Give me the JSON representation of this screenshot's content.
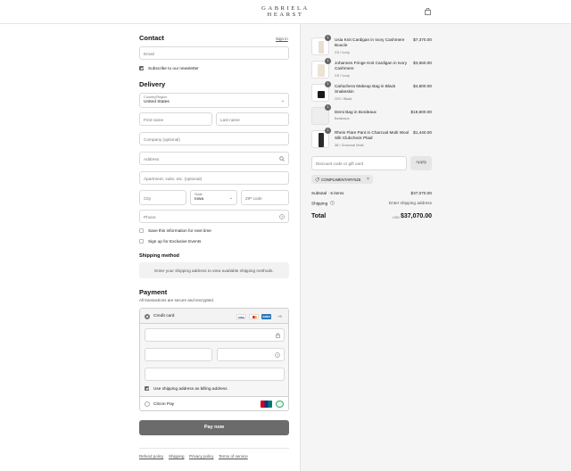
{
  "brand": {
    "logo_line1": "GABRIELA",
    "logo_line2": "HEARST",
    "bag_icon": "shopping-bag-icon"
  },
  "contact": {
    "title": "Contact",
    "sign_in": "Sign in",
    "email_placeholder": "Email",
    "newsletter_label": "Subscribe to our newsletter",
    "newsletter_checked": true
  },
  "delivery": {
    "title": "Delivery",
    "country_label": "Country/Region",
    "country_value": "United States",
    "first_name_placeholder": "First name",
    "last_name_placeholder": "Last name",
    "company_placeholder": "Company (optional)",
    "address_placeholder": "Address",
    "apartment_placeholder": "Apartment, suite, etc. (optional)",
    "city_placeholder": "City",
    "state_label": "State",
    "state_value": "Iowa",
    "zip_placeholder": "ZIP code",
    "phone_placeholder": "Phone",
    "save_info_label": "Save this information for next time",
    "exclusive_events_label": "Sign up for Exclusive Events"
  },
  "shipping": {
    "title": "Shipping method",
    "message": "Enter your shipping address to view available shipping methods."
  },
  "payment": {
    "title": "Payment",
    "subtitle": "All transactions are secure and encrypted.",
    "credit_card_label": "Credit card",
    "card_brands": [
      "VISA",
      "MC",
      "AMEX"
    ],
    "more_cards": "+3",
    "billing_label": "Use shipping address as billing address",
    "billing_checked": true,
    "alt_method_label": "Citcon Pay",
    "pay_button": "Pay now"
  },
  "footer_links": [
    "Refund policy",
    "Shipping",
    "Privacy policy",
    "Terms of service"
  ],
  "order": {
    "items": [
      {
        "name": "Usia Knit Cardigan in Ivory Cashmere Boucle",
        "variant": "XS / Ivory",
        "price": "$7,370.00",
        "qty": "1"
      },
      {
        "name": "Johannes Fringe Knit Cardigan in Ivory Cashmere",
        "variant": "XS / Ivory",
        "price": "$3,660.00",
        "qty": "1"
      },
      {
        "name": "Carluchera Makeup Bag in Black Snakeskin",
        "variant": "O/S / Black",
        "price": "$4,800.00",
        "qty": "1"
      },
      {
        "name": "Demi Bag in Bordeaux",
        "variant": "Bordeaux",
        "price": "$19,800.00",
        "qty": "1"
      },
      {
        "name": "Rhein Flare Pant in Charcoal Multi Wool Silk Clubcheck Plaid",
        "variant": "38 / Charcoal Multi",
        "price": "$1,440.00",
        "qty": "1"
      }
    ],
    "discount_placeholder": "Discount code or gift card",
    "apply_label": "Apply",
    "applied_code": "COMPLIMENTARY525",
    "subtotal_label": "Subtotal · 5 items",
    "subtotal_value": "$37,070.00",
    "shipping_label": "Shipping",
    "shipping_value": "Enter shipping address",
    "total_label": "Total",
    "currency": "USD",
    "total_value": "$37,070.00"
  }
}
